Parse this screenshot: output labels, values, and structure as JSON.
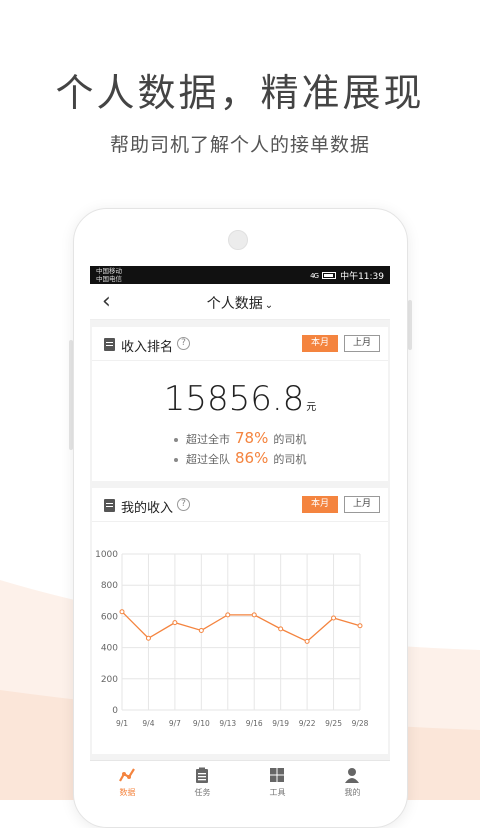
{
  "headline": "个人数据，精准展现",
  "subline": "帮助司机了解个人的接单数据",
  "status": {
    "carrier1": "中国移动",
    "carrier2": "中国电信",
    "signal": "4G",
    "time": "中午11:39"
  },
  "nav": {
    "title": "个人数据",
    "back_icon": "chevron-left-icon",
    "dropdown_icon": "chevron-down-icon"
  },
  "rank_card": {
    "title": "收入排名",
    "tab_current": "本月",
    "tab_last": "上月",
    "amount": "15856.8",
    "unit": "元",
    "line1_prefix": "超过全市",
    "line1_pct": "78%",
    "line1_suffix": "的司机",
    "line2_prefix": "超过全队",
    "line2_pct": "86%",
    "line2_suffix": "的司机"
  },
  "income_card": {
    "title": "我的收入",
    "tab_current": "本月",
    "tab_last": "上月"
  },
  "colors": {
    "accent": "#f4843f"
  },
  "chart_data": {
    "type": "line",
    "categories": [
      "9/1",
      "9/4",
      "9/7",
      "9/10",
      "9/13",
      "9/16",
      "9/19",
      "9/22",
      "9/25",
      "9/28"
    ],
    "values": [
      630,
      460,
      560,
      510,
      610,
      610,
      520,
      440,
      590,
      540
    ],
    "yticks": [
      0,
      200,
      400,
      600,
      800,
      1000
    ],
    "ylim": [
      0,
      1000
    ],
    "grid": true,
    "color": "#f4843f"
  },
  "tabbar": [
    {
      "label": "数据",
      "icon": "chart-icon",
      "active": true
    },
    {
      "label": "任务",
      "icon": "clipboard-icon",
      "active": false
    },
    {
      "label": "工具",
      "icon": "grid-icon",
      "active": false
    },
    {
      "label": "我的",
      "icon": "person-icon",
      "active": false
    }
  ]
}
